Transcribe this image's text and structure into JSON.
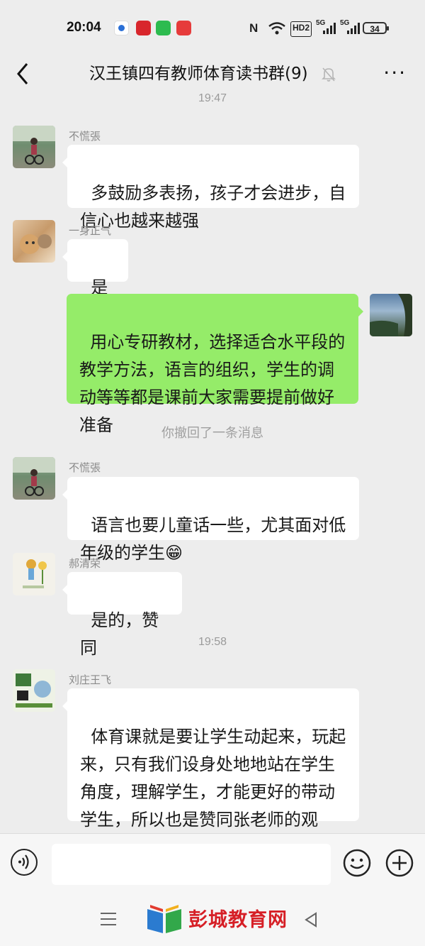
{
  "status_bar": {
    "time": "20:04",
    "icons": [
      "app-icon-blue",
      "app-icon-red-study",
      "wechat-icon",
      "app-icon-red"
    ],
    "signals": {
      "nfc": "N",
      "wifi": "wifi-icon",
      "hd": "HD2",
      "net1": "5G",
      "net2": "5G"
    },
    "battery": "34"
  },
  "header": {
    "title": "汉王镇四有教师体育读书群(9)",
    "back_icon": "chevron-left-icon",
    "mute_icon": "bell-off-icon",
    "more_label": "···"
  },
  "timestamps": {
    "t1": "19:47",
    "t2": "19:58"
  },
  "notice": "你撤回了一条消息",
  "messages": [
    {
      "sender": "不慌張",
      "text": "多鼓励多表扬，孩子才会进步，自\n信心也越来越强",
      "side": "left"
    },
    {
      "sender": "一身正气",
      "text": "是的",
      "side": "left"
    },
    {
      "sender": "",
      "text": "用心专研教材，选择适合水平段的\n教学方法，语言的组织，学生的调\n动等等都是课前大家需要提前做好\n准备",
      "side": "right"
    },
    {
      "sender": "不慌張",
      "text": "语言也要儿童话一些，尤其面对低\n年级的学生😁",
      "side": "left"
    },
    {
      "sender": "郝清荣",
      "text": "是的，赞同",
      "side": "left"
    },
    {
      "sender": "刘庄王飞",
      "text": "体育课就是要让学生动起来，玩起\n来，只有我们设身处地地站在学生\n角度，理解学生，才能更好的带动\n学生，所以也是赞同张老师的观\n点，用趣味性的语言引领孩子。",
      "side": "left"
    }
  ],
  "input_bar": {
    "voice_icon": "voice-icon",
    "emoji_icon": "emoji-icon",
    "plus_icon": "plus-icon"
  },
  "watermark": {
    "text": "彭城教育网"
  },
  "colors": {
    "bg": "#ededed",
    "self_bubble": "#95ec69",
    "other_bubble": "#ffffff",
    "watermark": "#d61f26"
  }
}
